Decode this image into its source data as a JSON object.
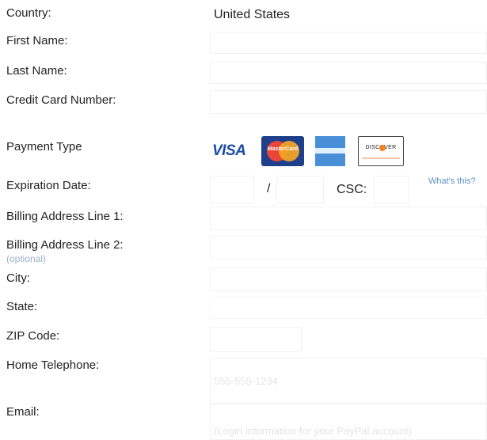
{
  "country": {
    "label": "Country:",
    "value": "United States"
  },
  "first_name": {
    "label": "First Name:"
  },
  "last_name": {
    "label": "Last Name:"
  },
  "card_number": {
    "label": "Credit Card Number:"
  },
  "payment_type": {
    "label": "Payment Type",
    "cards": [
      "VISA",
      "MasterCard",
      "American Express",
      "DISCOVER"
    ]
  },
  "expiration": {
    "label": "Expiration Date:",
    "separator": "/",
    "csc_label": "CSC:",
    "help_link": "What's this?"
  },
  "billing_line1": {
    "label": "Billing Address Line 1:"
  },
  "billing_line2": {
    "label": "Billing Address Line 2:",
    "optional": "(optional)"
  },
  "city": {
    "label": "City:"
  },
  "state": {
    "label": "State:"
  },
  "zip": {
    "label": "ZIP Code:"
  },
  "phone": {
    "label": "Home Telephone:",
    "placeholder": "555-555-1234"
  },
  "email": {
    "label": "Email:",
    "placeholder": "(Login information for your PayPal account)"
  }
}
